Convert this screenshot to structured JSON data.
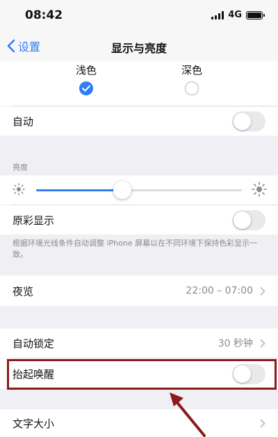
{
  "status": {
    "time": "08:42",
    "network": "4G"
  },
  "nav": {
    "back_label": "设置",
    "title": "显示与亮度"
  },
  "appearance": {
    "light_label": "浅色",
    "dark_label": "深色",
    "selected": "light"
  },
  "auto": {
    "label": "自动",
    "on": false
  },
  "brightness": {
    "header": "亮度",
    "level": 0.42
  },
  "true_tone": {
    "label": "原彩显示",
    "on": false,
    "footnote": "根据环境光线条件自动调整 iPhone 屏幕以在不同环境下保持色彩显示一致。"
  },
  "night_shift": {
    "label": "夜览",
    "value": "22:00 – 07:00"
  },
  "auto_lock": {
    "label": "自动锁定",
    "value": "30 秒钟"
  },
  "raise_to_wake": {
    "label": "抬起唤醒",
    "on": false
  },
  "text_size": {
    "label": "文字大小"
  },
  "colors": {
    "accent": "#2f7ef6",
    "highlight": "#8b1a1a",
    "background": "#efeff4"
  }
}
